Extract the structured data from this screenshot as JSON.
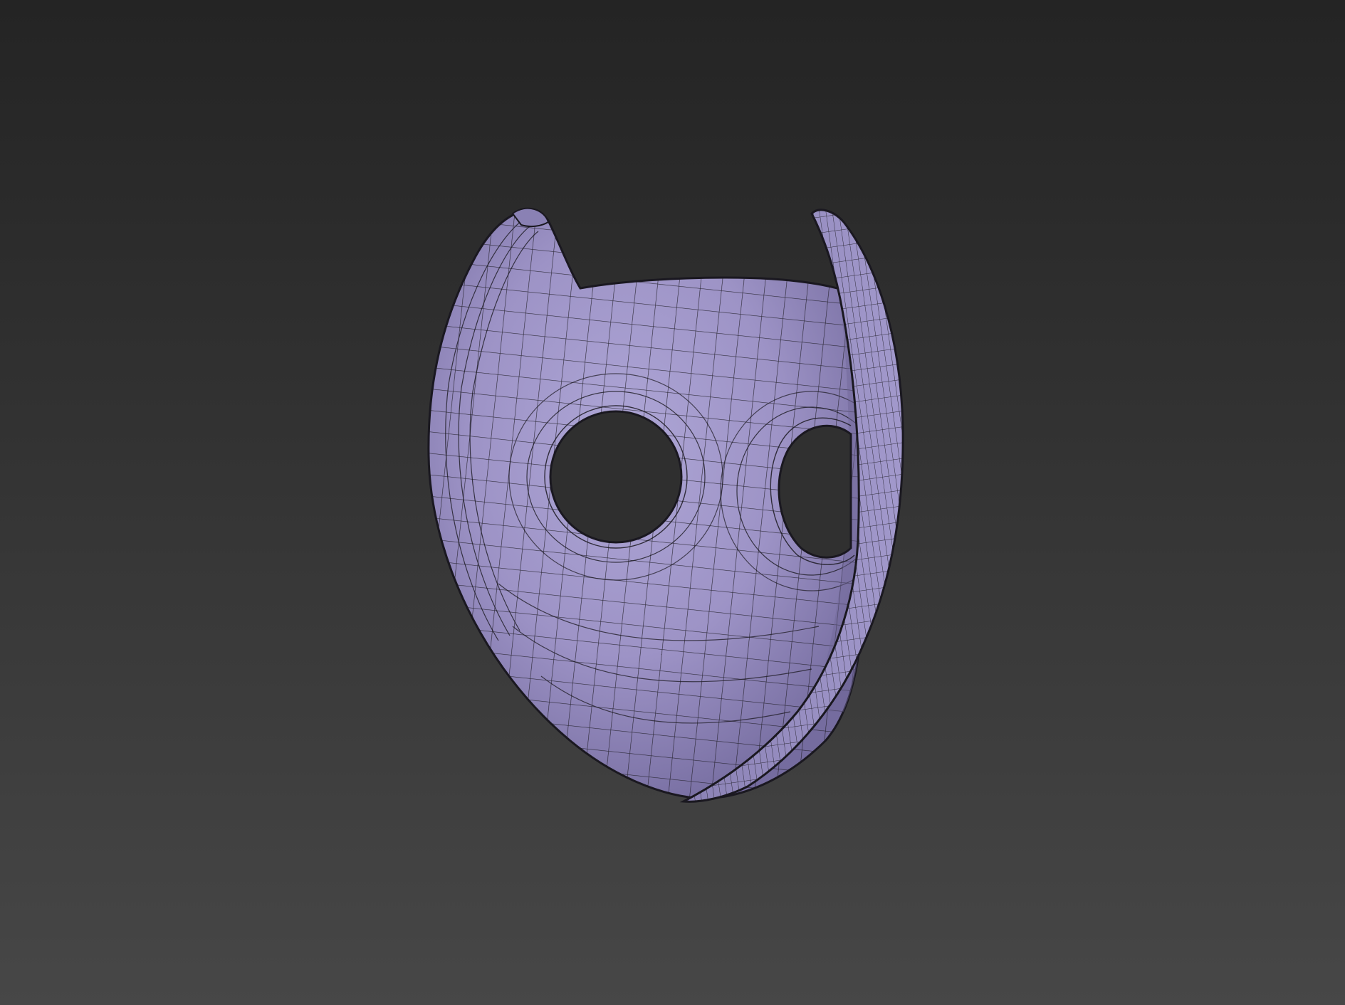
{
  "viewport": {
    "background_top": "#242424",
    "background_bottom": "#474747"
  },
  "model": {
    "name": "mask-mesh",
    "surface_color": "#9d93c6",
    "surface_shadow": "#6f6898",
    "wire_color": "#1c1a22",
    "display_mode": "shaded-with-wireframe"
  }
}
